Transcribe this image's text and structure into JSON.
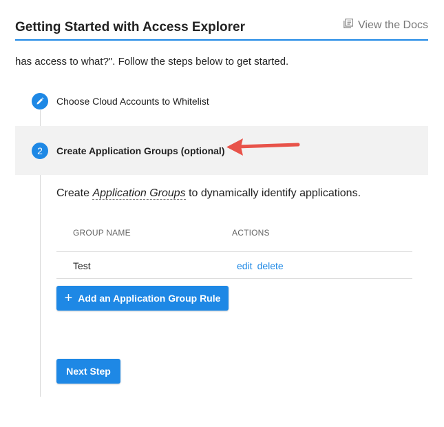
{
  "header": {
    "title": "Getting Started with Access Explorer",
    "docs_label": "View the Docs"
  },
  "intro": "has access to what?\". Follow the steps below to get started.",
  "steps": [
    {
      "label": "Choose Cloud Accounts to Whitelist",
      "status": "edit",
      "icon": "pencil-icon"
    },
    {
      "label": "Create Application Groups (optional)",
      "number": "2",
      "active": true
    }
  ],
  "description": {
    "prefix": "Create ",
    "term": "Application Groups",
    "suffix": " to dynamically identify applications."
  },
  "table": {
    "columns": [
      "GROUP NAME",
      "ACTIONS"
    ],
    "rows": [
      {
        "name": "Test",
        "actions": [
          "edit",
          "delete"
        ]
      }
    ]
  },
  "buttons": {
    "add_rule": "Add an Application Group Rule",
    "next_step": "Next Step"
  },
  "colors": {
    "accent": "#1e88e5",
    "arrow": "#e8534a",
    "active_step_bg": "#f2f2f2"
  }
}
